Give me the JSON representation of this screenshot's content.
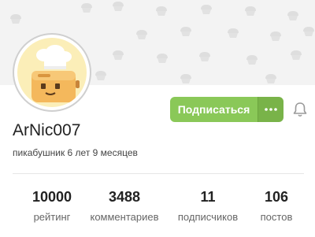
{
  "profile": {
    "username": "ArNic007",
    "tenure": "пикабушник 6 лет 9 месяцев",
    "avatar_icon": "toaster-chef-icon"
  },
  "actions": {
    "subscribe_label": "Подписаться",
    "more_label": "···",
    "more_icon": "more-dots-icon",
    "notify_icon": "bell-icon"
  },
  "stats": [
    {
      "value": "10000",
      "label": "рейтинг"
    },
    {
      "value": "3488",
      "label": "комментариев"
    },
    {
      "value": "11",
      "label": "подписчиков"
    },
    {
      "value": "106",
      "label": "постов"
    }
  ],
  "colors": {
    "accent": "#8ac858",
    "accent_dark": "#79b349",
    "cover_bg": "#f3f3f3",
    "avatar_bg": "#fbeeb8"
  }
}
